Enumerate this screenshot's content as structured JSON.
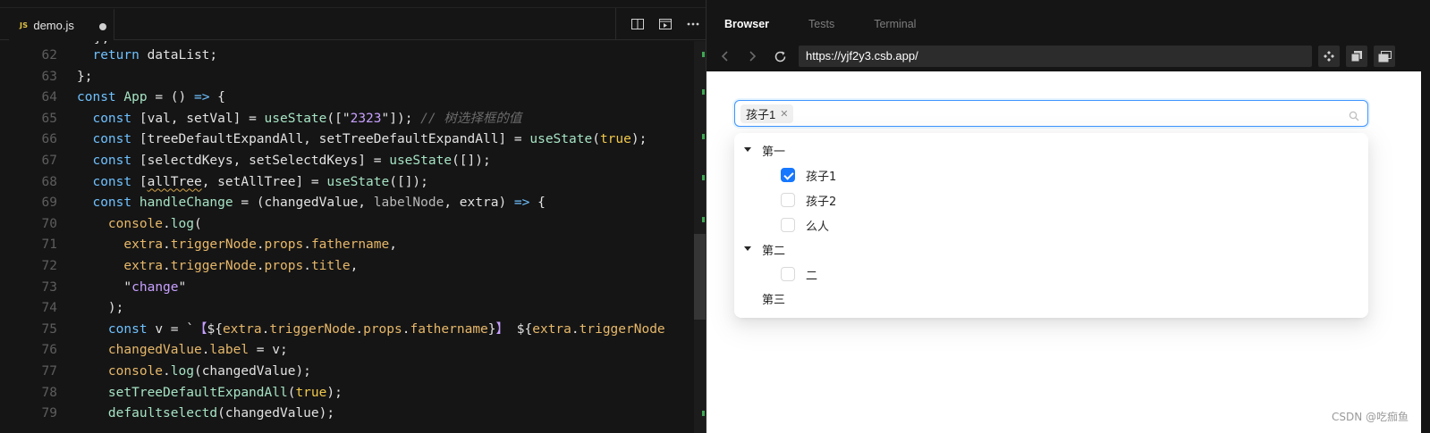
{
  "editor": {
    "tab": {
      "badge": "JS",
      "filename": "demo.js",
      "modified": true
    },
    "actions": [
      "split-editor-icon",
      "preview-icon",
      "more-icon"
    ],
    "partial_line": "};",
    "lines": [
      {
        "n": "62",
        "tokens": [
          [
            "  ",
            "punc"
          ],
          [
            "return ",
            "kw"
          ],
          [
            "dataList",
            "var"
          ],
          [
            ";",
            "punc"
          ]
        ]
      },
      {
        "n": "63",
        "tokens": [
          [
            "};",
            "punc"
          ]
        ]
      },
      {
        "n": "64",
        "tokens": [
          [
            "const ",
            "kw"
          ],
          [
            "App",
            "fn"
          ],
          [
            " = () ",
            "punc"
          ],
          [
            "=>",
            "kw"
          ],
          [
            " {",
            "punc"
          ]
        ]
      },
      {
        "n": "65",
        "tokens": [
          [
            "  ",
            "punc"
          ],
          [
            "const ",
            "kw"
          ],
          [
            "[val, setVal] = ",
            "var"
          ],
          [
            "useState",
            "fn"
          ],
          [
            "([\"",
            "punc"
          ],
          [
            "2323",
            "str"
          ],
          [
            "\"]); ",
            "punc"
          ],
          [
            "// 树选择框的值",
            "cm"
          ]
        ]
      },
      {
        "n": "66",
        "tokens": [
          [
            "  ",
            "punc"
          ],
          [
            "const ",
            "kw"
          ],
          [
            "[treeDefaultExpandAll, setTreeDefaultExpandAll] = ",
            "var"
          ],
          [
            "useState",
            "fn"
          ],
          [
            "(",
            "punc"
          ],
          [
            "true",
            "bool"
          ],
          [
            ");",
            "punc"
          ]
        ]
      },
      {
        "n": "67",
        "tokens": [
          [
            "  ",
            "punc"
          ],
          [
            "const ",
            "kw"
          ],
          [
            "[selectdKeys, setSelectdKeys] = ",
            "var"
          ],
          [
            "useState",
            "fn"
          ],
          [
            "([]);",
            "punc"
          ]
        ]
      },
      {
        "n": "68",
        "tokens": [
          [
            "  ",
            "punc"
          ],
          [
            "const ",
            "kw"
          ],
          [
            "[",
            "punc"
          ],
          [
            "allTree",
            "squig"
          ],
          [
            ", setAllTree] = ",
            "var"
          ],
          [
            "useState",
            "fn"
          ],
          [
            "([]);",
            "punc"
          ]
        ]
      },
      {
        "n": "69",
        "tokens": [
          [
            "  ",
            "punc"
          ],
          [
            "const ",
            "kw"
          ],
          [
            "handleChange",
            "fn"
          ],
          [
            " = (changedValue, ",
            "var"
          ],
          [
            "labelNode",
            "param"
          ],
          [
            ", extra) ",
            "var"
          ],
          [
            "=>",
            "kw"
          ],
          [
            " {",
            "punc"
          ]
        ]
      },
      {
        "n": "70",
        "tokens": [
          [
            "    ",
            "punc"
          ],
          [
            "console",
            "obj"
          ],
          [
            ".",
            "punc"
          ],
          [
            "log",
            "fn"
          ],
          [
            "(",
            "punc"
          ]
        ]
      },
      {
        "n": "71",
        "tokens": [
          [
            "      ",
            "punc"
          ],
          [
            "extra",
            "obj"
          ],
          [
            ".",
            "punc"
          ],
          [
            "triggerNode",
            "prop"
          ],
          [
            ".",
            "punc"
          ],
          [
            "props",
            "prop"
          ],
          [
            ".",
            "punc"
          ],
          [
            "fathername",
            "prop"
          ],
          [
            ",",
            "punc"
          ]
        ]
      },
      {
        "n": "72",
        "tokens": [
          [
            "      ",
            "punc"
          ],
          [
            "extra",
            "obj"
          ],
          [
            ".",
            "punc"
          ],
          [
            "triggerNode",
            "prop"
          ],
          [
            ".",
            "punc"
          ],
          [
            "props",
            "prop"
          ],
          [
            ".",
            "punc"
          ],
          [
            "title",
            "prop"
          ],
          [
            ",",
            "punc"
          ]
        ]
      },
      {
        "n": "73",
        "tokens": [
          [
            "      ",
            "punc"
          ],
          [
            "\"",
            "punc"
          ],
          [
            "change",
            "str"
          ],
          [
            "\"",
            "punc"
          ]
        ]
      },
      {
        "n": "74",
        "tokens": [
          [
            "    ",
            "punc"
          ],
          [
            ");",
            "punc"
          ]
        ]
      },
      {
        "n": "75",
        "tokens": [
          [
            "    ",
            "punc"
          ],
          [
            "const ",
            "kw"
          ],
          [
            "v = `",
            "var"
          ],
          [
            "【",
            "str"
          ],
          [
            "${",
            "punc"
          ],
          [
            "extra",
            "obj"
          ],
          [
            ".",
            "punc"
          ],
          [
            "triggerNode",
            "prop"
          ],
          [
            ".",
            "punc"
          ],
          [
            "props",
            "prop"
          ],
          [
            ".",
            "punc"
          ],
          [
            "fathername",
            "prop"
          ],
          [
            "}",
            "punc"
          ],
          [
            "】 ",
            "str"
          ],
          [
            "${",
            "punc"
          ],
          [
            "extra",
            "obj"
          ],
          [
            ".",
            "punc"
          ],
          [
            "triggerNode",
            "prop"
          ]
        ]
      },
      {
        "n": "76",
        "tokens": [
          [
            "    ",
            "punc"
          ],
          [
            "changedValue",
            "obj"
          ],
          [
            ".",
            "punc"
          ],
          [
            "label",
            "prop"
          ],
          [
            " = v;",
            "var"
          ]
        ]
      },
      {
        "n": "77",
        "tokens": [
          [
            "    ",
            "punc"
          ],
          [
            "console",
            "obj"
          ],
          [
            ".",
            "punc"
          ],
          [
            "log",
            "fn"
          ],
          [
            "(changedValue);",
            "var"
          ]
        ]
      },
      {
        "n": "78",
        "tokens": [
          [
            "    ",
            "punc"
          ],
          [
            "setTreeDefaultExpandAll",
            "fn"
          ],
          [
            "(",
            "punc"
          ],
          [
            "true",
            "bool"
          ],
          [
            ");",
            "punc"
          ]
        ]
      },
      {
        "n": "79",
        "tokens": [
          [
            "    ",
            "punc"
          ],
          [
            "defaultselectd",
            "fn"
          ],
          [
            "(changedValue);",
            "var"
          ]
        ]
      }
    ]
  },
  "browser": {
    "tabs": [
      {
        "label": "Browser",
        "active": true
      },
      {
        "label": "Tests",
        "active": false
      },
      {
        "label": "Terminal",
        "active": false
      }
    ],
    "url": "https://yjf2y3.csb.app/",
    "tree_select": {
      "selected_tag": "孩子1",
      "nodes": [
        {
          "label": "第一",
          "level": 0,
          "expanded": true,
          "checkbox": false
        },
        {
          "label": "孩子1",
          "level": 1,
          "checkbox": true,
          "checked": true
        },
        {
          "label": "孩子2",
          "level": 1,
          "checkbox": true,
          "checked": false
        },
        {
          "label": "么人",
          "level": 1,
          "checkbox": true,
          "checked": false
        },
        {
          "label": "第二",
          "level": 0,
          "expanded": true,
          "checkbox": false
        },
        {
          "label": "二",
          "level": 1,
          "checkbox": true,
          "checked": false
        },
        {
          "label": "第三",
          "level": 0,
          "expanded": false,
          "checkbox": false
        }
      ]
    }
  },
  "watermark": "CSDN @吃痂鱼",
  "colors": {
    "accent": "#1677ff",
    "editor_bg": "#151515",
    "keyword": "#6fc1ff"
  }
}
